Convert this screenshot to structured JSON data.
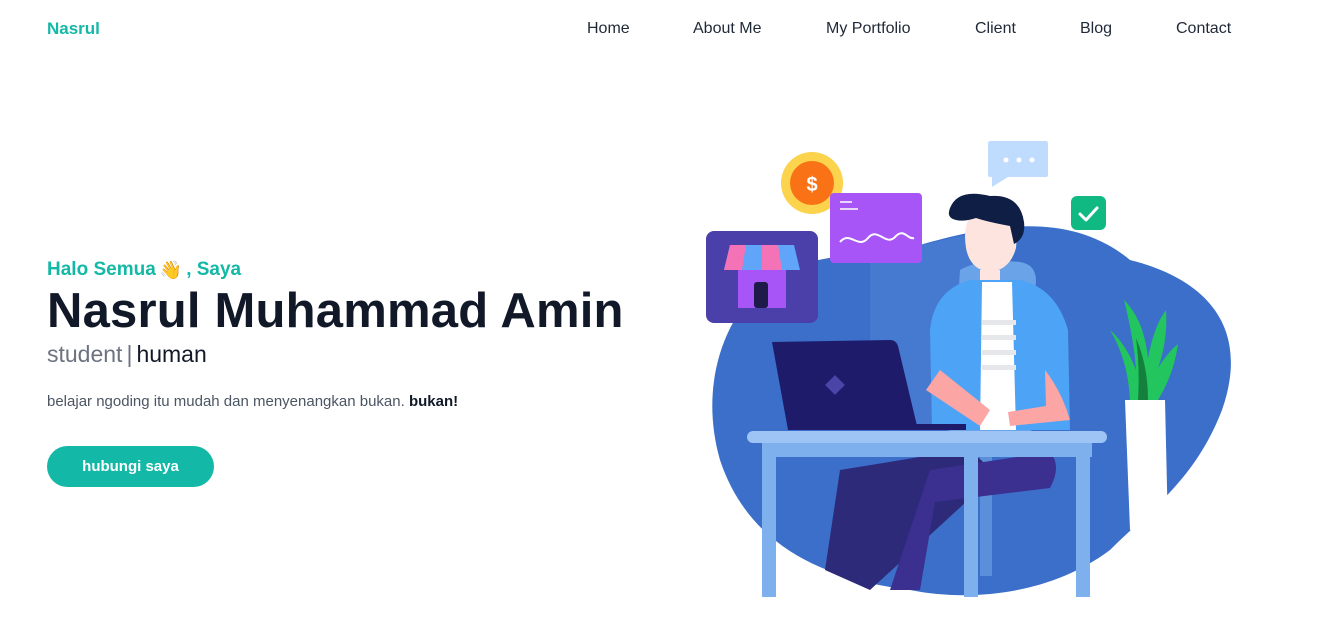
{
  "nav": {
    "brand": "Nasrul",
    "links": [
      "Home",
      "About Me",
      "My Portfolio",
      "Client",
      "Blog",
      "Contact"
    ]
  },
  "hero": {
    "greeting_before": "Halo Semua",
    "greeting_emoji": "👋",
    "greeting_after": ", Saya",
    "name": "Nasrul Muhammad Amin",
    "role_primary": "student",
    "role_separator": "|",
    "role_secondary": "human",
    "tagline": "belajar ngoding itu mudah dan menyenangkan bukan.",
    "tagline_strong": "bukan!",
    "cta_label": "hubungi saya"
  },
  "illustration": {
    "coin_symbol": "$"
  },
  "colors": {
    "accent": "#14b8a6",
    "heading": "#111827",
    "blob": "#3b6fc9"
  }
}
